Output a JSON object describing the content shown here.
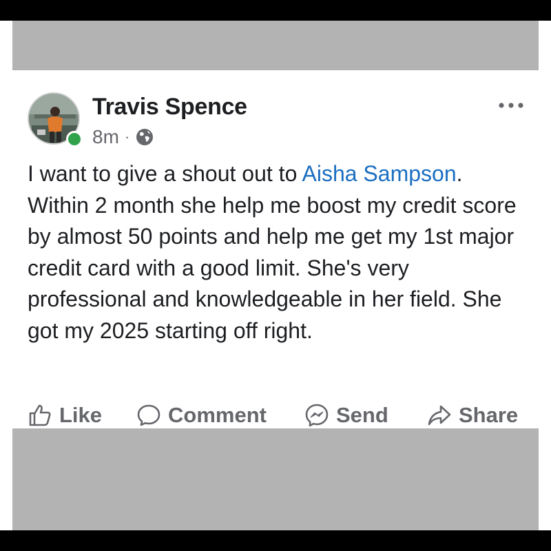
{
  "post": {
    "author": "Travis Spence",
    "timestamp": "8m",
    "separator": "·",
    "privacy_icon": "globe-icon",
    "more_icon": "more-options-icon",
    "body": {
      "part1": "I want to give a shout out to ",
      "mention": "Aisha Sampson",
      "part2": ". Within 2 month she help me boost my credit score by almost 50 points and help me get my 1st major credit card with a good limit. She's very professional and knowledgeable in her field. She got my 2025 starting off right."
    },
    "actions": {
      "like": "Like",
      "comment": "Comment",
      "send": "Send",
      "share": "Share"
    },
    "colors": {
      "mention": "#1b6ec2",
      "online": "#31a24c",
      "muted": "#65676b",
      "text": "#1c1e21"
    }
  }
}
